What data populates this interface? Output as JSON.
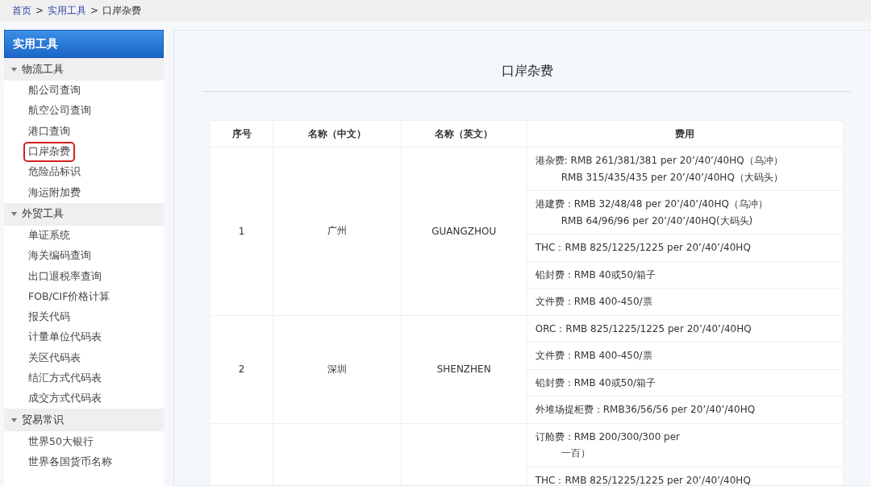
{
  "breadcrumb": [
    {
      "label": "首页",
      "link": true
    },
    {
      "label": ">",
      "link": false
    },
    {
      "label": "实用工具",
      "link": true
    },
    {
      "label": ">",
      "link": false
    },
    {
      "label": "口岸杂费",
      "link": false
    }
  ],
  "sidebar": {
    "title": "实用工具",
    "groups": [
      {
        "label": "物流工具",
        "expanded": true,
        "items": [
          {
            "label": "船公司查询",
            "highlighted": false
          },
          {
            "label": "航空公司查询",
            "highlighted": false
          },
          {
            "label": "港口查询",
            "highlighted": false
          },
          {
            "label": "口岸杂费",
            "highlighted": true
          },
          {
            "label": "危险品标识",
            "highlighted": false
          },
          {
            "label": "海运附加费",
            "highlighted": false
          }
        ]
      },
      {
        "label": "外贸工具",
        "expanded": true,
        "items": [
          {
            "label": "单证系统",
            "highlighted": false
          },
          {
            "label": "海关编码查询",
            "highlighted": false
          },
          {
            "label": "出口退税率查询",
            "highlighted": false
          },
          {
            "label": "FOB/CIF价格计算",
            "highlighted": false
          },
          {
            "label": "报关代码",
            "highlighted": false
          },
          {
            "label": "计量单位代码表",
            "highlighted": false
          },
          {
            "label": "关区代码表",
            "highlighted": false
          },
          {
            "label": "结汇方式代码表",
            "highlighted": false
          },
          {
            "label": "成交方式代码表",
            "highlighted": false
          }
        ]
      },
      {
        "label": "贸易常识",
        "expanded": true,
        "items": [
          {
            "label": "世界50大银行",
            "highlighted": false
          },
          {
            "label": "世界各国货币名称",
            "highlighted": false
          }
        ]
      }
    ]
  },
  "page_title": "口岸杂费",
  "table": {
    "columns": [
      "序号",
      "名称（中文）",
      "名称（英文）",
      "费用"
    ],
    "rows": [
      {
        "index": "1",
        "name_cn": "广州",
        "name_en": "GUANGZHOU",
        "fees": [
          [
            "港杂费: RMB 261/381/381 per 20’/40’/40HQ（乌冲）",
            "RMB 315/435/435 per 20’/40’/40HQ（大码头）"
          ],
          [
            "港建费：RMB 32/48/48 per 20’/40’/40HQ（乌冲）",
            "RMB 64/96/96 per 20’/40’/40HQ(大码头)"
          ],
          [
            "THC：RMB 825/1225/1225 per 20’/40’/40HQ"
          ],
          [
            "铅封费：RMB 40或50/箱子"
          ],
          [
            "文件费：RMB 400-450/票"
          ]
        ]
      },
      {
        "index": "2",
        "name_cn": "深圳",
        "name_en": "SHENZHEN",
        "fees": [
          [
            "ORC：RMB 825/1225/1225 per 20’/40’/40HQ"
          ],
          [
            "文件费：RMB 400-450/票"
          ],
          [
            "铅封费：RMB 40或50/箱子"
          ],
          [
            "外堆场提柜费：RMB36/56/56 per 20’/40’/40HQ"
          ]
        ]
      },
      {
        "index": "",
        "name_cn": "",
        "name_en": "",
        "fees": [
          [
            "订舱费：RMB 200/300/300 per",
            "一百）"
          ],
          [
            "THC：RMB 825/1225/1225 per 20’/40’/40HQ"
          ]
        ]
      }
    ]
  }
}
